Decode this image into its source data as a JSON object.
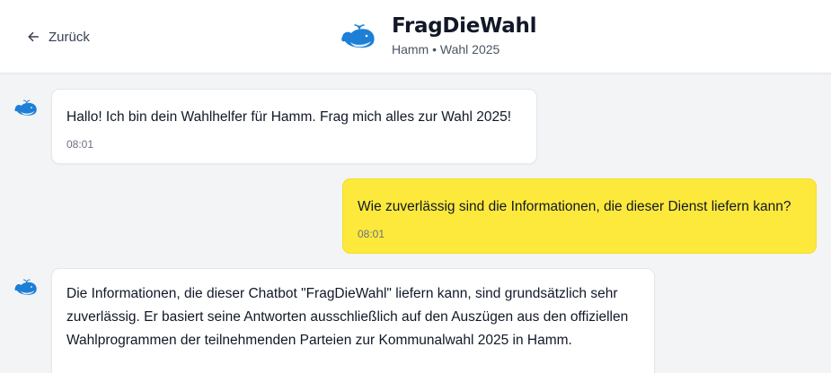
{
  "header": {
    "back_label": "Zurück",
    "title": "FragDieWahl",
    "subtitle": "Hamm • Wahl 2025"
  },
  "messages": [
    {
      "sender": "bot",
      "text": "Hallo! Ich bin dein Wahlhelfer für Hamm. Frag mich alles zur Wahl 2025!",
      "time": "08:01"
    },
    {
      "sender": "user",
      "text": "Wie zuverlässig sind die Informationen, die dieser Dienst liefern kann?",
      "time": "08:01"
    },
    {
      "sender": "bot",
      "text": "Die Informationen, die dieser Chatbot \"FragDieWahl\" liefern kann, sind grundsätzlich sehr zuverlässig. Er basiert seine Antworten ausschließlich auf den Auszügen aus den offiziellen Wahlprogrammen der teilnehmenden Parteien zur Kommunalwahl 2025 in Hamm."
    }
  ],
  "colors": {
    "accent_whale": "#1d7fd6",
    "user_bubble": "#fde93b",
    "background": "#f3f4f6"
  },
  "icons": {
    "back": "arrow-left-icon",
    "logo": "whale-logo-icon",
    "avatar": "whale-avatar-icon"
  }
}
